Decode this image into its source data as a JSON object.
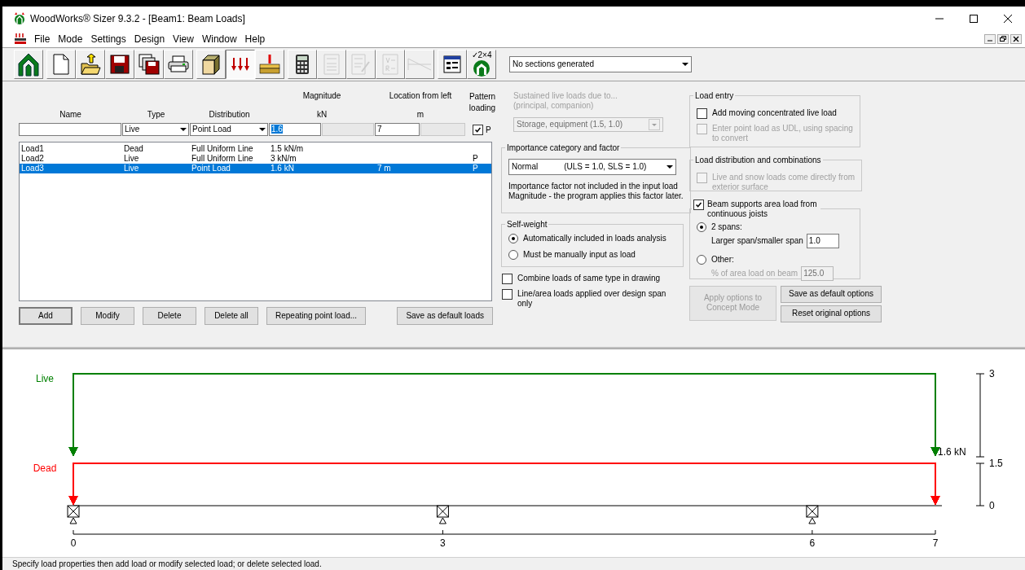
{
  "window": {
    "title": "WoodWorks® Sizer 9.3.2 - [Beam1: Beam Loads]"
  },
  "menu": [
    "File",
    "Mode",
    "Settings",
    "Design",
    "View",
    "Window",
    "Help"
  ],
  "toolbar_groups": [
    {
      "buttons": [
        {
          "kind": "home",
          "selected": false,
          "disabled": false
        }
      ]
    },
    {
      "buttons": [
        {
          "kind": "new",
          "selected": false,
          "disabled": false
        },
        {
          "kind": "open",
          "selected": false,
          "disabled": false
        },
        {
          "kind": "save",
          "selected": false,
          "disabled": false
        },
        {
          "kind": "save-all",
          "selected": false,
          "disabled": false
        },
        {
          "kind": "print",
          "selected": false,
          "disabled": false
        }
      ]
    },
    {
      "buttons": [
        {
          "kind": "beam",
          "selected": false,
          "disabled": false
        },
        {
          "kind": "loads",
          "selected": true,
          "disabled": false
        },
        {
          "kind": "point",
          "selected": false,
          "disabled": false
        }
      ]
    },
    {
      "buttons": [
        {
          "kind": "calculator",
          "selected": false,
          "disabled": false
        },
        {
          "kind": "report",
          "selected": false,
          "disabled": true
        },
        {
          "kind": "report-edit",
          "selected": false,
          "disabled": true
        },
        {
          "kind": "vr",
          "selected": false,
          "disabled": true
        },
        {
          "kind": "diagram",
          "selected": false,
          "disabled": true
        }
      ]
    },
    {
      "buttons": [
        {
          "kind": "sheet",
          "selected": false,
          "disabled": false
        },
        {
          "kind": "check",
          "label": "✓2×4",
          "selected": false,
          "disabled": false
        }
      ]
    }
  ],
  "sections_dropdown": {
    "value": "No sections generated"
  },
  "load_form": {
    "headers": {
      "name": "Name",
      "type": "Type",
      "distribution": "Distribution",
      "magnitude": "Magnitude",
      "magnitude_unit": "kN",
      "location": "Location from left",
      "location_unit": "m",
      "pattern": "Pattern loading"
    },
    "type": "Live",
    "distribution": "Point Load",
    "magnitude": "1.6",
    "location": "7",
    "pattern": {
      "checked": true,
      "label": "P"
    }
  },
  "loads": [
    {
      "name": "Load1",
      "type": "Dead",
      "distribution": "Full Uniform Line",
      "magnitude": "1.5 kN/m",
      "selected": false
    },
    {
      "name": "Load2",
      "type": "Live",
      "distribution": "Full Uniform Line",
      "magnitude": "3 kN/m",
      "pattern": "P",
      "selected": false
    },
    {
      "name": "Load3",
      "type": "Live",
      "distribution": "Point Load",
      "magnitude": "1.6 kN",
      "location": "7 m",
      "pattern": "P",
      "selected": true
    }
  ],
  "load_buttons": [
    {
      "label": "Add",
      "default": true
    },
    {
      "label": "Modify",
      "default": false
    },
    {
      "label": "Delete",
      "default": false
    },
    {
      "label": "Delete all",
      "default": false
    },
    {
      "label": "Repeating point load...",
      "default": false
    },
    {
      "label": "Save as default loads",
      "default": false
    }
  ],
  "sustained": {
    "lines": [
      "Sustained live loads due to...",
      "(principal, companion)"
    ],
    "value": "Storage, equipment (1.5, 1.0)",
    "disabled": true
  },
  "importance": {
    "title": "Importance category and factor",
    "value": "Normal",
    "factors": "(ULS = 1.0, SLS = 1.0)",
    "note": [
      "Importance factor not included in the input load",
      "Magnitude - the program applies this factor later."
    ]
  },
  "self_weight": {
    "title": "Self-weight",
    "options": [
      {
        "label": "Automatically included in loads analysis",
        "selected": true
      },
      {
        "label": "Must be manually input as load",
        "selected": false
      }
    ]
  },
  "drawing_options": [
    {
      "lines": [
        "Combine loads of same type in drawing"
      ],
      "checked": false
    },
    {
      "lines": [
        "Line/area loads applied over design span",
        "only"
      ],
      "checked": false
    }
  ],
  "load_entry": {
    "title": "Load entry",
    "options": [
      {
        "lines": [
          "Add moving concentrated live load"
        ],
        "checked": false,
        "disabled": false
      },
      {
        "lines": [
          "Enter point load as UDL, using spacing",
          "to convert"
        ],
        "checked": false,
        "disabled": true
      }
    ]
  },
  "load_distribution": {
    "title": "Load distribution and combinations",
    "options": [
      {
        "lines": [
          "Live and snow loads come directly from",
          "exterior surface"
        ],
        "checked": false,
        "disabled": true
      }
    ]
  },
  "beam_supports": {
    "lines": [
      "Beam supports area load from",
      "continuous joists"
    ],
    "checked": true,
    "options": [
      {
        "label": "2 spans:",
        "selected": true,
        "field_label": "Larger span/smaller span",
        "value": "1.0",
        "disabled": false
      },
      {
        "label": "Other:",
        "selected": false,
        "field_label": "% of area load on beam",
        "value": "125.0",
        "disabled": true
      }
    ]
  },
  "option_buttons": [
    {
      "lines": [
        "Apply options to",
        "Concept Mode"
      ],
      "disabled": true
    },
    {
      "lines": [
        "Save as default options"
      ],
      "disabled": false
    },
    {
      "lines": [
        "Reset original options"
      ],
      "disabled": false
    }
  ],
  "diagram": {
    "loads": [
      {
        "label": "Live",
        "color": "#008000",
        "end_label": "1.6 kN"
      },
      {
        "label": "Dead",
        "color": "#ff0000"
      }
    ],
    "scale_ticks": [
      "3",
      "1.5",
      "0"
    ],
    "span_ticks": [
      "0",
      "3",
      "6",
      "7"
    ]
  },
  "status_bar": {
    "text": "Specify load properties then add load or modify selected load; or delete selected load."
  }
}
